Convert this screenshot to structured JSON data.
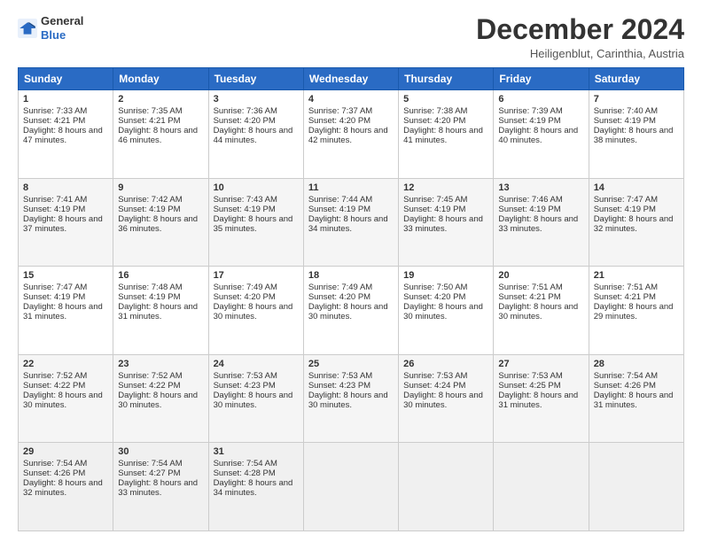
{
  "logo": {
    "line1": "General",
    "line2": "Blue"
  },
  "title": "December 2024",
  "subtitle": "Heiligenblut, Carinthia, Austria",
  "headers": [
    "Sunday",
    "Monday",
    "Tuesday",
    "Wednesday",
    "Thursday",
    "Friday",
    "Saturday"
  ],
  "weeks": [
    [
      {
        "day": 1,
        "sunrise": "7:33 AM",
        "sunset": "4:21 PM",
        "daylight": "8 hours and 47 minutes."
      },
      {
        "day": 2,
        "sunrise": "7:35 AM",
        "sunset": "4:21 PM",
        "daylight": "8 hours and 46 minutes."
      },
      {
        "day": 3,
        "sunrise": "7:36 AM",
        "sunset": "4:20 PM",
        "daylight": "8 hours and 44 minutes."
      },
      {
        "day": 4,
        "sunrise": "7:37 AM",
        "sunset": "4:20 PM",
        "daylight": "8 hours and 42 minutes."
      },
      {
        "day": 5,
        "sunrise": "7:38 AM",
        "sunset": "4:20 PM",
        "daylight": "8 hours and 41 minutes."
      },
      {
        "day": 6,
        "sunrise": "7:39 AM",
        "sunset": "4:19 PM",
        "daylight": "8 hours and 40 minutes."
      },
      {
        "day": 7,
        "sunrise": "7:40 AM",
        "sunset": "4:19 PM",
        "daylight": "8 hours and 38 minutes."
      }
    ],
    [
      {
        "day": 8,
        "sunrise": "7:41 AM",
        "sunset": "4:19 PM",
        "daylight": "8 hours and 37 minutes."
      },
      {
        "day": 9,
        "sunrise": "7:42 AM",
        "sunset": "4:19 PM",
        "daylight": "8 hours and 36 minutes."
      },
      {
        "day": 10,
        "sunrise": "7:43 AM",
        "sunset": "4:19 PM",
        "daylight": "8 hours and 35 minutes."
      },
      {
        "day": 11,
        "sunrise": "7:44 AM",
        "sunset": "4:19 PM",
        "daylight": "8 hours and 34 minutes."
      },
      {
        "day": 12,
        "sunrise": "7:45 AM",
        "sunset": "4:19 PM",
        "daylight": "8 hours and 33 minutes."
      },
      {
        "day": 13,
        "sunrise": "7:46 AM",
        "sunset": "4:19 PM",
        "daylight": "8 hours and 33 minutes."
      },
      {
        "day": 14,
        "sunrise": "7:47 AM",
        "sunset": "4:19 PM",
        "daylight": "8 hours and 32 minutes."
      }
    ],
    [
      {
        "day": 15,
        "sunrise": "7:47 AM",
        "sunset": "4:19 PM",
        "daylight": "8 hours and 31 minutes."
      },
      {
        "day": 16,
        "sunrise": "7:48 AM",
        "sunset": "4:19 PM",
        "daylight": "8 hours and 31 minutes."
      },
      {
        "day": 17,
        "sunrise": "7:49 AM",
        "sunset": "4:20 PM",
        "daylight": "8 hours and 30 minutes."
      },
      {
        "day": 18,
        "sunrise": "7:49 AM",
        "sunset": "4:20 PM",
        "daylight": "8 hours and 30 minutes."
      },
      {
        "day": 19,
        "sunrise": "7:50 AM",
        "sunset": "4:20 PM",
        "daylight": "8 hours and 30 minutes."
      },
      {
        "day": 20,
        "sunrise": "7:51 AM",
        "sunset": "4:21 PM",
        "daylight": "8 hours and 30 minutes."
      },
      {
        "day": 21,
        "sunrise": "7:51 AM",
        "sunset": "4:21 PM",
        "daylight": "8 hours and 29 minutes."
      }
    ],
    [
      {
        "day": 22,
        "sunrise": "7:52 AM",
        "sunset": "4:22 PM",
        "daylight": "8 hours and 30 minutes."
      },
      {
        "day": 23,
        "sunrise": "7:52 AM",
        "sunset": "4:22 PM",
        "daylight": "8 hours and 30 minutes."
      },
      {
        "day": 24,
        "sunrise": "7:53 AM",
        "sunset": "4:23 PM",
        "daylight": "8 hours and 30 minutes."
      },
      {
        "day": 25,
        "sunrise": "7:53 AM",
        "sunset": "4:23 PM",
        "daylight": "8 hours and 30 minutes."
      },
      {
        "day": 26,
        "sunrise": "7:53 AM",
        "sunset": "4:24 PM",
        "daylight": "8 hours and 30 minutes."
      },
      {
        "day": 27,
        "sunrise": "7:53 AM",
        "sunset": "4:25 PM",
        "daylight": "8 hours and 31 minutes."
      },
      {
        "day": 28,
        "sunrise": "7:54 AM",
        "sunset": "4:26 PM",
        "daylight": "8 hours and 31 minutes."
      }
    ],
    [
      {
        "day": 29,
        "sunrise": "7:54 AM",
        "sunset": "4:26 PM",
        "daylight": "8 hours and 32 minutes."
      },
      {
        "day": 30,
        "sunrise": "7:54 AM",
        "sunset": "4:27 PM",
        "daylight": "8 hours and 33 minutes."
      },
      {
        "day": 31,
        "sunrise": "7:54 AM",
        "sunset": "4:28 PM",
        "daylight": "8 hours and 34 minutes."
      },
      null,
      null,
      null,
      null
    ]
  ]
}
